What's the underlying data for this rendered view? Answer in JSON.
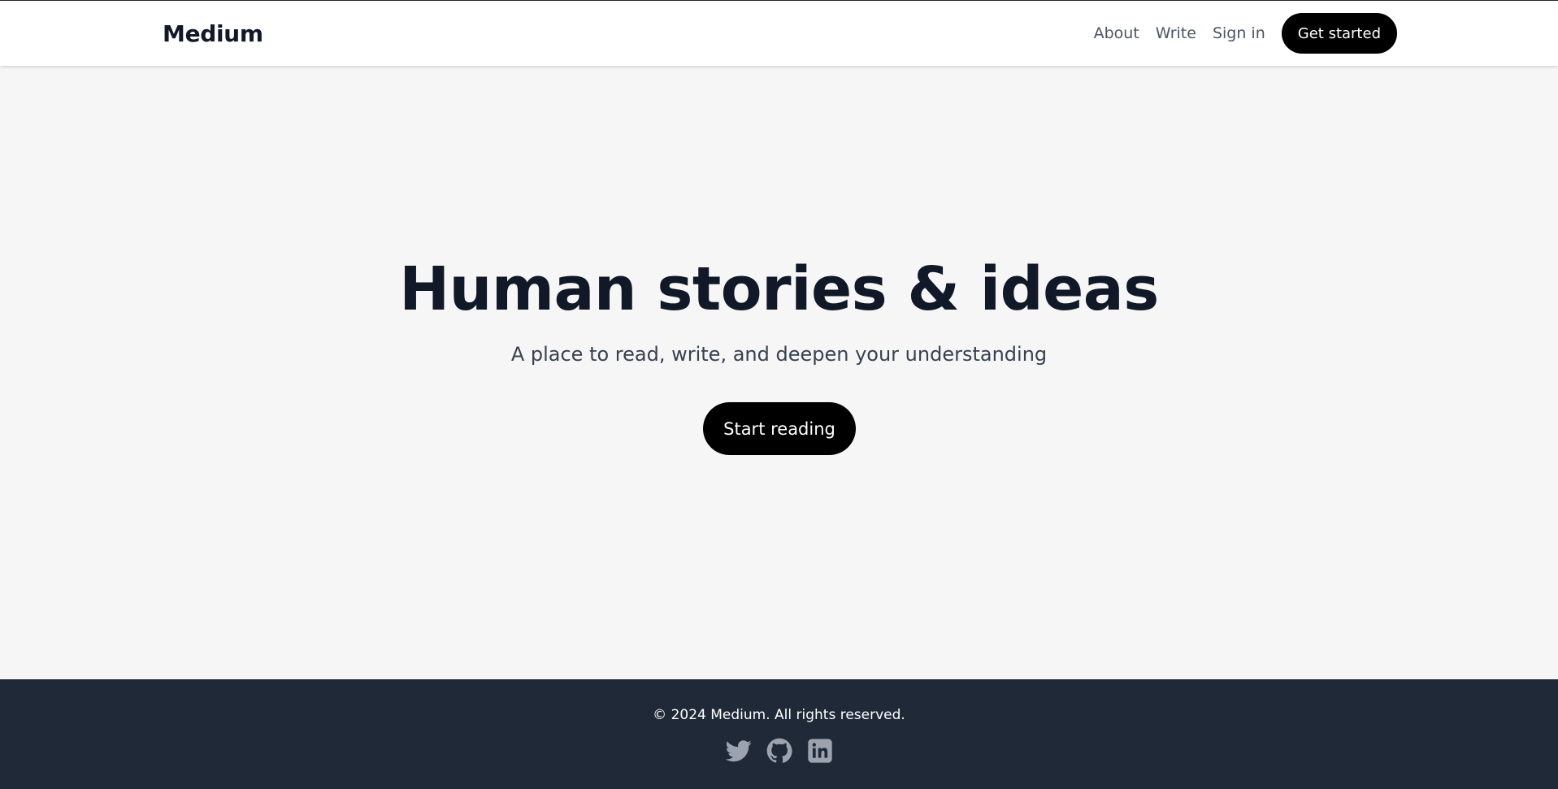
{
  "header": {
    "logo": "Medium",
    "nav": {
      "about": "About",
      "write": "Write",
      "sign_in": "Sign in",
      "get_started": "Get started"
    }
  },
  "hero": {
    "title": "Human stories & ideas",
    "subtitle": "A place to read, write, and deepen your understanding",
    "cta": "Start reading"
  },
  "footer": {
    "copyright": "© 2024 Medium. All rights reserved.",
    "social_icons": [
      "twitter-icon",
      "github-icon",
      "linkedin-icon"
    ]
  },
  "colors": {
    "page_background": "#f6f6f6",
    "header_background": "#ffffff",
    "footer_background": "#1f2937",
    "primary_text": "#111827",
    "secondary_text": "#374151",
    "nav_text": "#4b5563",
    "button_background": "#000000",
    "button_text": "#ffffff",
    "social_icon": "#9ca3af"
  }
}
